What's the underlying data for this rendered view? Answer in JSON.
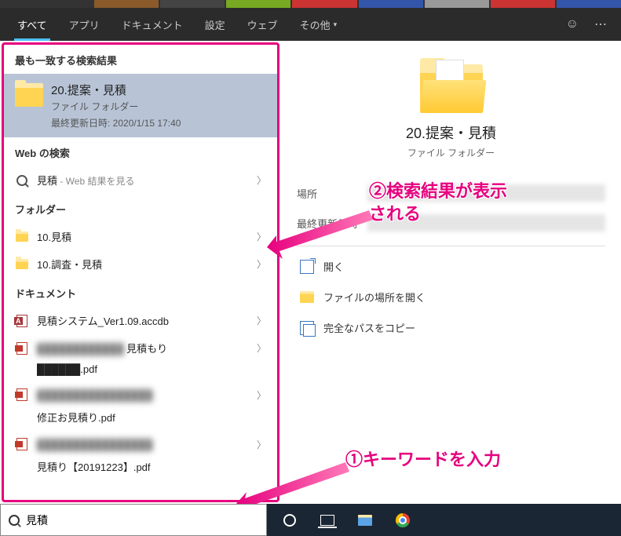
{
  "tabs": {
    "all": "すべて",
    "apps": "アプリ",
    "documents": "ドキュメント",
    "settings": "設定",
    "web": "ウェブ",
    "more": "その他"
  },
  "results": {
    "best_match_header": "最も一致する検索結果",
    "best_match": {
      "title": "20.提案・見積",
      "type": "ファイル フォルダー",
      "date_label": "最終更新日時: 2020/1/15 17:40"
    },
    "web_header": "Web の検索",
    "web_item": {
      "query": "見積",
      "suffix": " - Web 結果を見る"
    },
    "folders_header": "フォルダー",
    "folders": [
      {
        "name": "10.見積"
      },
      {
        "name": "10.調査・見積"
      }
    ],
    "documents_header": "ドキュメント",
    "documents": [
      {
        "name": "見積システム_Ver1.09.accdb",
        "icon": "access"
      },
      {
        "name_suffix": "見積もり",
        "line2": ".pdf",
        "icon": "pdf",
        "blurred": true
      },
      {
        "line2": "修正お見積り.pdf",
        "icon": "pdf",
        "blurred": true
      },
      {
        "line2": "見積り【20191223】.pdf",
        "icon": "pdf",
        "blurred": true
      }
    ]
  },
  "detail": {
    "title": "20.提案・見積",
    "type": "ファイル フォルダー",
    "meta": [
      {
        "k": "場所",
        "blurred": true
      },
      {
        "k": "最終更新日時",
        "blurred": true
      }
    ],
    "actions": {
      "open": "開く",
      "location": "ファイルの場所を開く",
      "copy_path": "完全なパスをコピー"
    }
  },
  "annotations": {
    "step1": "①キーワードを入力",
    "step2_l1": "②検索結果が表示",
    "step2_l2": "される"
  },
  "search": {
    "value": "見積"
  },
  "colors": {
    "accent": "#e6007e"
  }
}
